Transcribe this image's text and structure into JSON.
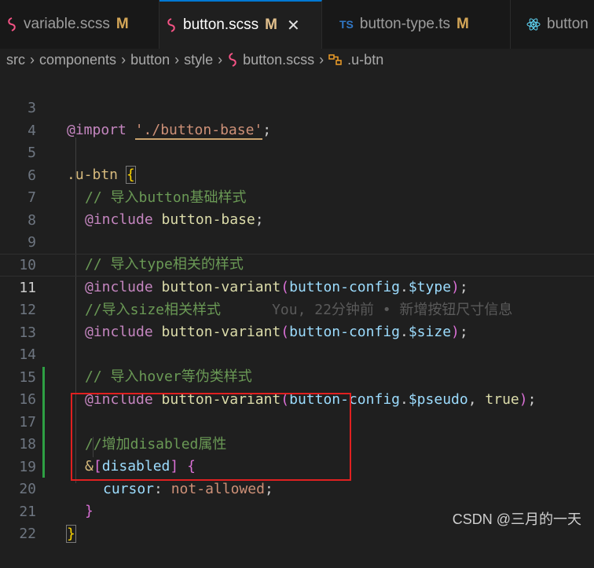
{
  "tabs": [
    {
      "label": "variable.scss",
      "modified": "M",
      "icon": "sass-icon",
      "active": false
    },
    {
      "label": "button.scss",
      "modified": "M",
      "icon": "sass-icon",
      "active": true,
      "close": "✕"
    },
    {
      "label": "button-type.ts",
      "modified": "M",
      "icon": "typescript-icon",
      "icon_text": "TS",
      "active": false
    },
    {
      "label": "button",
      "modified": "",
      "icon": "react-icon",
      "active": false
    }
  ],
  "breadcrumb": [
    "src",
    "components",
    "button",
    "style",
    "button.scss",
    ".u-btn"
  ],
  "editor": {
    "current_line": 11,
    "lines": [
      {
        "n": "3",
        "code": "@import './button-base';"
      },
      {
        "n": "4",
        "code": ""
      },
      {
        "n": "5",
        "code": ".u-btn {"
      },
      {
        "n": "6",
        "code": "// 导入button基础样式"
      },
      {
        "n": "7",
        "code": "@include button-base;"
      },
      {
        "n": "8",
        "code": ""
      },
      {
        "n": "9",
        "code": "// 导入type相关的样式"
      },
      {
        "n": "10",
        "code": "@include button-variant(button-config.$type);"
      },
      {
        "n": "11",
        "code": "//导入size相关样式",
        "blame": "You, 22分钟前 • 新增按钮尺寸信息"
      },
      {
        "n": "12",
        "code": "@include button-variant(button-config.$size);"
      },
      {
        "n": "13",
        "code": ""
      },
      {
        "n": "14",
        "code": "// 导入hover等伪类样式"
      },
      {
        "n": "15",
        "code": "@include button-variant(button-config.$pseudo, true);"
      },
      {
        "n": "16",
        "code": ""
      },
      {
        "n": "17",
        "code": "//增加disabled属性"
      },
      {
        "n": "18",
        "code": "&[disabled] {"
      },
      {
        "n": "19",
        "code": "cursor: not-allowed;"
      },
      {
        "n": "20",
        "code": "}"
      },
      {
        "n": "21",
        "code": "}"
      },
      {
        "n": "22",
        "code": ""
      }
    ]
  },
  "watermark": "CSDN @三月的一天",
  "colors": {
    "accent": "#0078d4",
    "added": "#2ea043",
    "highlight_box": "#e02020"
  }
}
